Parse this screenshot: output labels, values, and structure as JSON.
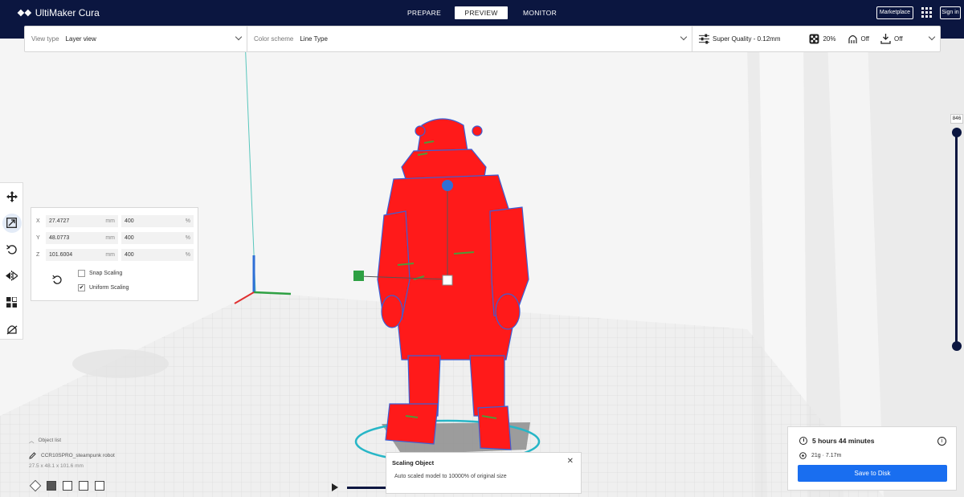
{
  "app": {
    "title": "UltiMaker Cura",
    "logo_mark": "❖❖"
  },
  "stages": {
    "prepare": "PREPARE",
    "preview": "PREVIEW",
    "monitor": "MONITOR"
  },
  "header": {
    "marketplace": "Marketplace",
    "signin": "Sign in"
  },
  "toolbar": {
    "view_type_label": "View type",
    "view_type_value": "Layer view",
    "color_scheme_label": "Color scheme",
    "color_scheme_value": "Line Type",
    "profile": "Super Quality - 0.12mm",
    "infill": "20%",
    "support": "Off",
    "adhesion": "Off"
  },
  "scale": {
    "x_label": "X",
    "x_mm": "27.4727",
    "x_pct": "400",
    "y_label": "Y",
    "y_mm": "48.0773",
    "y_pct": "400",
    "z_label": "Z",
    "z_mm": "101.6004",
    "z_pct": "400",
    "unit_mm": "mm",
    "unit_pct": "%",
    "snap_label": "Snap Scaling",
    "snap_checked": false,
    "uniform_label": "Uniform Scaling",
    "uniform_checked": true
  },
  "layer_slider": {
    "max_layer": "846"
  },
  "object_list": {
    "toggle_label": "Object list",
    "object_name": "CCR10SPRO_steampunk robot",
    "dimensions": "27.5 x 48.1 x 101.6 mm"
  },
  "notification": {
    "title": "Scaling Object",
    "body": "Auto scaled model to 10000% of original size",
    "close": "✕"
  },
  "print_info": {
    "time": "5 hours 44 minutes",
    "material": "21g · 7.17m",
    "save_button": "Save to Disk",
    "info_glyph": "i"
  },
  "colors": {
    "header_bg": "#0b1640",
    "model_red": "#ff1a1a",
    "model_outline": "#3a5fd6",
    "accent_blue": "#196ef0",
    "axis_green": "#2ea043",
    "axis_blue": "#2f6fd6",
    "axis_red": "#e03030"
  }
}
